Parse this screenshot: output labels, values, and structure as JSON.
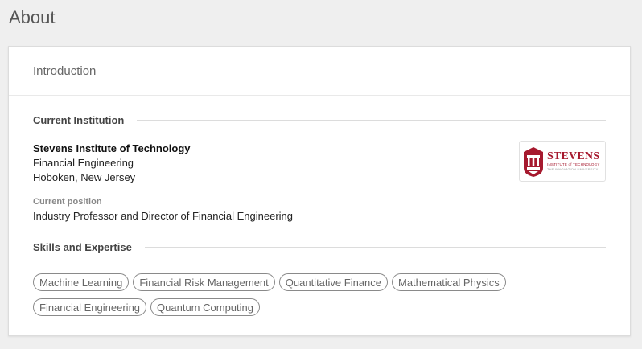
{
  "page": {
    "title": "About"
  },
  "card": {
    "title": "Introduction"
  },
  "institution": {
    "heading": "Current Institution",
    "name": "Stevens Institute of Technology",
    "department": "Financial Engineering",
    "location": "Hoboken, New Jersey",
    "logo": {
      "word": "STEVENS",
      "subtitle": "INSTITUTE of TECHNOLOGY",
      "tagline": "THE INNOVATION UNIVERSITY",
      "color": "#a6192e"
    }
  },
  "position": {
    "label": "Current position",
    "value": "Industry Professor and Director of Financial Engineering"
  },
  "skills": {
    "heading": "Skills and Expertise",
    "items": [
      "Machine Learning",
      "Financial Risk Management",
      "Quantitative Finance",
      "Mathematical Physics",
      "Financial Engineering",
      "Quantum Computing"
    ]
  }
}
